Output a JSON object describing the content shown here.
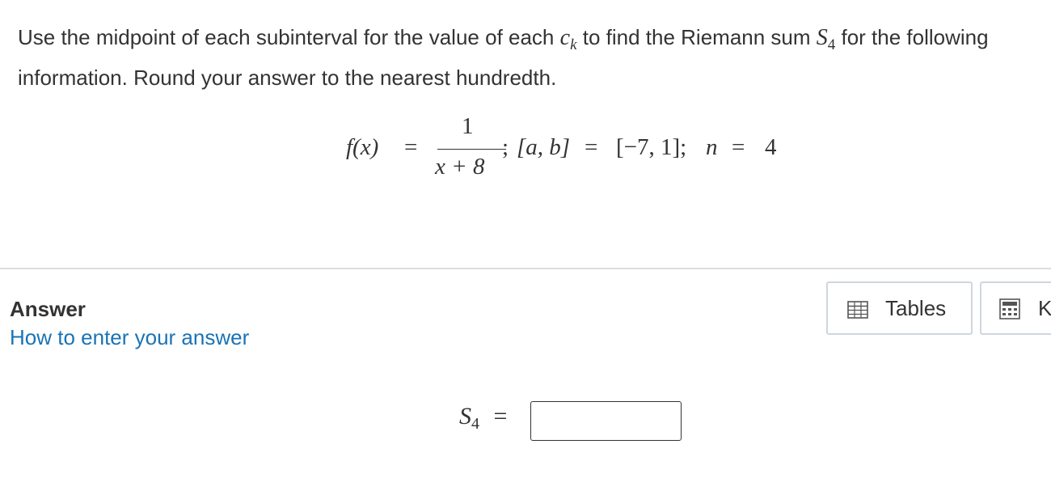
{
  "question": {
    "text_1": "Use the midpoint of each subinterval for the value of each ",
    "ck_base": "c",
    "ck_sub": "k",
    "text_2": " to find the Riemann sum ",
    "s4_base": "S",
    "s4_sub": "4",
    "text_3": " for the following information. Round your answer to the nearest hundredth."
  },
  "formula": {
    "lhs": "f(x)",
    "eq1": "=",
    "numerator": "1",
    "denominator": "x + 8",
    "sep1": ";",
    "interval_lhs": "[a, b]",
    "eq2": "=",
    "interval_rhs": "[−7, 1];",
    "n_label": "n",
    "eq3": "=",
    "n_value": "4"
  },
  "answer": {
    "heading": "Answer",
    "help_link": "How to enter your answer",
    "sum_base": "S",
    "sum_sub": "4",
    "equals": "=",
    "input_value": "",
    "input_placeholder": ""
  },
  "tools": {
    "tables_label": "Tables",
    "keypad_label": "K",
    "tables_icon": "table-icon",
    "keypad_icon": "calculator-icon"
  }
}
